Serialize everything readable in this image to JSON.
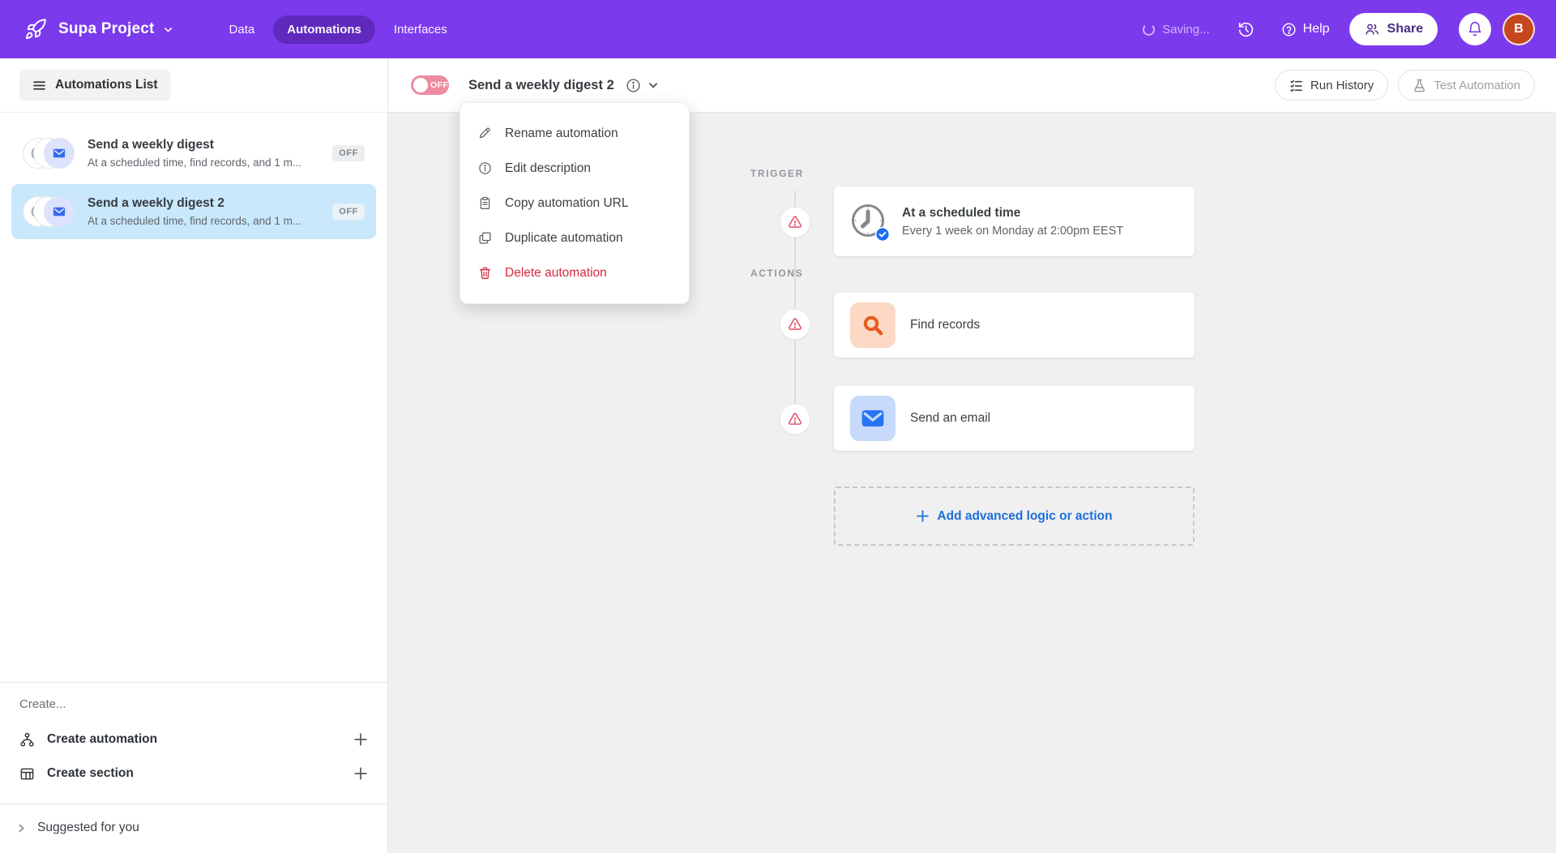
{
  "header": {
    "project_name": "Supa Project",
    "tabs": {
      "data": "Data",
      "automations": "Automations",
      "interfaces": "Interfaces"
    },
    "saving_text": "Saving...",
    "help_label": "Help",
    "share_label": "Share",
    "avatar_initial": "B"
  },
  "toolbar": {
    "list_toggle_label": "Automations List",
    "toggle_state": "OFF",
    "automation_title": "Send a weekly digest 2",
    "run_history_label": "Run History",
    "test_automation_label": "Test Automation"
  },
  "sidebar": {
    "items": [
      {
        "title": "Send a weekly digest",
        "subtitle": "At a scheduled time, find records, and 1 m...",
        "status": "OFF"
      },
      {
        "title": "Send a weekly digest 2",
        "subtitle": "At a scheduled time, find records, and 1 m...",
        "status": "OFF"
      }
    ],
    "create_heading": "Create...",
    "create_automation": "Create automation",
    "create_section": "Create section",
    "suggested": "Suggested for you"
  },
  "context_menu": {
    "items": [
      {
        "label": "Rename automation",
        "icon": "pencil-icon"
      },
      {
        "label": "Edit description",
        "icon": "info-icon"
      },
      {
        "label": "Copy automation URL",
        "icon": "clipboard-icon"
      },
      {
        "label": "Duplicate automation",
        "icon": "duplicate-icon"
      },
      {
        "label": "Delete automation",
        "icon": "trash-icon"
      }
    ]
  },
  "canvas": {
    "trigger_label": "TRIGGER",
    "actions_label": "ACTIONS",
    "trigger_card": {
      "title": "At a scheduled time",
      "subtitle": "Every 1 week on Monday at 2:00pm EEST"
    },
    "actions": [
      {
        "title": "Find records"
      },
      {
        "title": "Send an email"
      }
    ],
    "add_button_label": "Add advanced logic or action"
  },
  "colors": {
    "header_purple": "#7c3aed",
    "selected_item_blue": "#c9e8fb",
    "toggle_off_pink": "#ee8ba0",
    "warning_red": "#e0445f",
    "danger_red": "#d6293f",
    "link_blue": "#1c6fd8",
    "search_orange": "#e65c20",
    "email_blue": "#2774f4",
    "avatar_orange": "#c5471d"
  }
}
